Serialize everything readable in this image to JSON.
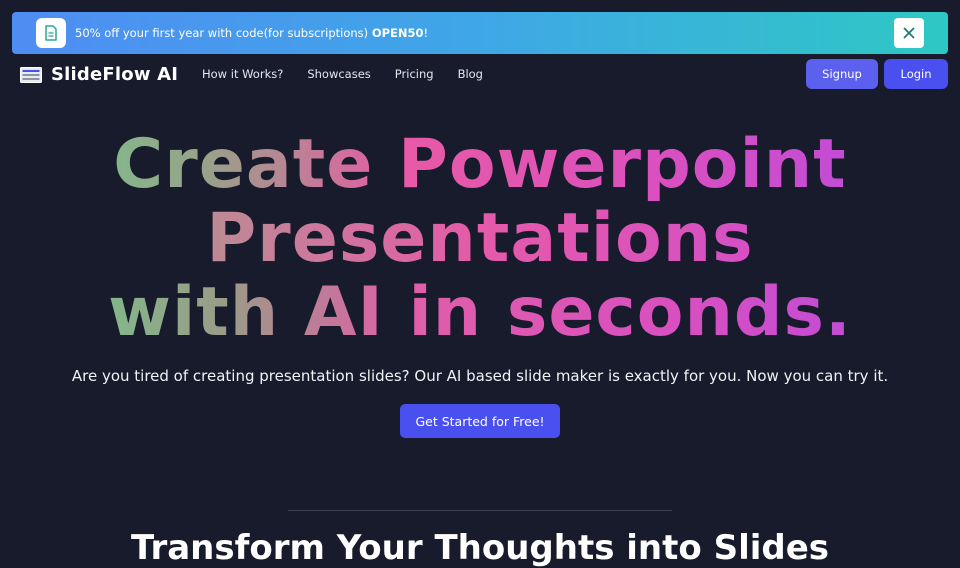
{
  "banner": {
    "text_prefix": "50% off your first year with code(for subscriptions) ",
    "code": "OPEN50",
    "text_suffix": "!",
    "icon": "document-icon",
    "close_icon": "close-icon"
  },
  "nav": {
    "brand": "SlideFlow AI",
    "links": [
      "How it Works?",
      "Showcases",
      "Pricing",
      "Blog"
    ],
    "signup_label": "Signup",
    "login_label": "Login"
  },
  "hero": {
    "lines": [
      "Create Powerpoint",
      "Presentations",
      "with AI in seconds."
    ],
    "subtitle": "Are you tired of creating presentation slides? Our AI based slide maker is exactly for you. Now you can try it.",
    "cta_label": "Get Started for Free!"
  },
  "section": {
    "title": "Transform Your Thoughts into Slides"
  },
  "colors": {
    "background": "#171b2b",
    "accent": "#4a4ff0",
    "banner_start": "#4f8df3",
    "banner_end": "#2ec8c4",
    "gradient_green": "#6cd08a",
    "gradient_pink": "#e85aa6",
    "gradient_purple": "#b44be3"
  }
}
